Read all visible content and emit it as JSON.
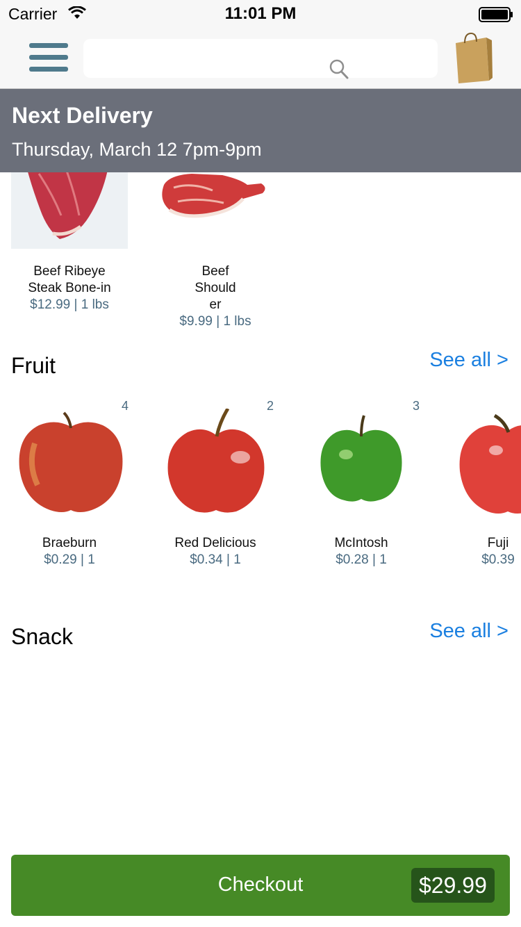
{
  "status_bar": {
    "carrier": "Carrier",
    "time": "11:01 PM"
  },
  "nav": {
    "search_placeholder": ""
  },
  "delivery": {
    "title": "Next Delivery",
    "time": "Thursday, March 12 7pm-9pm"
  },
  "meat_items": [
    {
      "name": "Beef Ribeye Steak Bone-in",
      "price": "$12.99 | 1 lbs"
    },
    {
      "name": "Beef Should er",
      "name_lines": [
        "Beef",
        "Should",
        "er"
      ],
      "price": "$9.99 | 1 lbs"
    }
  ],
  "fruit": {
    "title": "Fruit",
    "see_all": "See all >",
    "items": [
      {
        "name": "Braeburn",
        "price": "$0.29 | 1",
        "count": "4",
        "color": "#c9412d"
      },
      {
        "name": "Red Delicious",
        "price": "$0.34 | 1",
        "count": "2",
        "color": "#d2372c"
      },
      {
        "name": "McIntosh",
        "price": "$0.28 | 1",
        "count": "3",
        "color": "#3f9a2a"
      },
      {
        "name": "Fuji",
        "price": "$0.39",
        "count": "",
        "color": "#e0413a"
      }
    ]
  },
  "snack": {
    "title": "Snack",
    "see_all": "See all >"
  },
  "checkout": {
    "label": "Checkout",
    "total": "$29.99"
  },
  "colors": {
    "accent": "#1a7fe0",
    "checkout_green": "#468a26",
    "banner_gray": "#6b6f7a",
    "menu_blue": "#4f7a8c"
  }
}
